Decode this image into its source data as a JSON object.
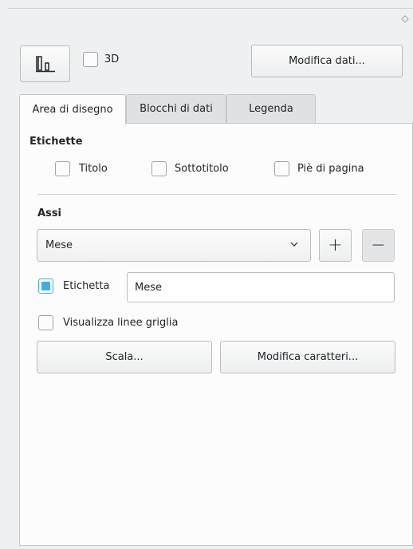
{
  "toolbar": {
    "chart_type_icon": "bar-chart-icon",
    "threeD_label": "3D",
    "threeD_checked": false,
    "edit_data_label": "Modifica dati..."
  },
  "tabs": [
    {
      "label": "Area di disegno",
      "active": true
    },
    {
      "label": "Blocchi di dati",
      "active": false
    },
    {
      "label": "Legenda",
      "active": false
    }
  ],
  "labels_section": {
    "heading": "Etichette",
    "title_label": "Titolo",
    "subtitle_label": "Sottotitolo",
    "footer_label": "Piè di pagina"
  },
  "axes_section": {
    "heading": "Assi",
    "selected_axis": "Mese",
    "add_symbol": "+",
    "remove_symbol": "−",
    "label_checkbox_label": "Etichetta",
    "label_checked": true,
    "label_value": "Mese",
    "gridlines_label": "Visualizza linee griglia",
    "scale_button": "Scala...",
    "font_button": "Modifica caratteri..."
  },
  "colors": {
    "accent": "#3daee9",
    "background": "#eff0f1",
    "panel": "#fcfcfc"
  }
}
